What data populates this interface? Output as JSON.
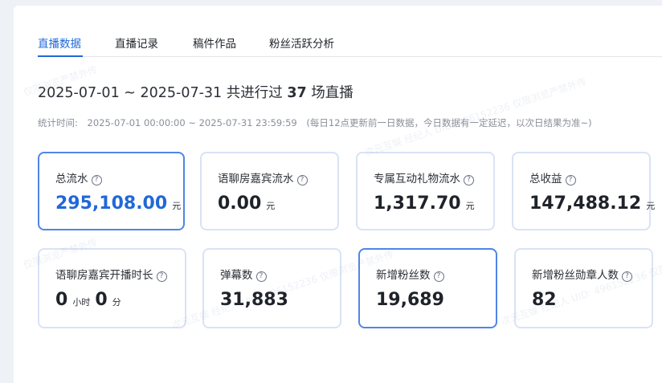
{
  "tabs": [
    {
      "label": "直播数据"
    },
    {
      "label": "直播记录"
    },
    {
      "label": "稿件作品"
    },
    {
      "label": "粉丝活跃分析"
    }
  ],
  "summary": {
    "range": "2025-07-01 ~ 2025-07-31",
    "prefix": "共进行过",
    "count": "37",
    "suffix": "场直播"
  },
  "stat_time": {
    "label": "统计时间:",
    "range": "2025-07-01 00:00:00 ~ 2025-07-31 23:59:59",
    "note": "(每日12点更新前一日数据，今日数据有一定延迟，以次日结果为准~)"
  },
  "cards": [
    {
      "title": "总流水",
      "value": "295,108.00",
      "unit": "元"
    },
    {
      "title": "语聊房嘉宾流水",
      "value": "0.00",
      "unit": "元"
    },
    {
      "title": "专属互动礼物流水",
      "value": "1,317.70",
      "unit": "元"
    },
    {
      "title": "总收益",
      "value": "147,488.12",
      "unit": "元"
    },
    {
      "title": "语聊房嘉宾开播时长",
      "hours": "0",
      "hours_unit": "小时",
      "minutes": "0",
      "minutes_unit": "分"
    },
    {
      "title": "弹幕数",
      "value": "31,883"
    },
    {
      "title": "新增粉丝数",
      "value": "19,689"
    },
    {
      "title": "新增粉丝勋章人数",
      "value": "82"
    }
  ],
  "help_glyph": "?",
  "watermark": {
    "text1": "次元互娱 经纪人 UID: 496152236 仅限浏览严禁外传",
    "text2": "仅限浏览严禁外传"
  },
  "colors": {
    "accent": "#2168d8",
    "selected_border": "#4f86e6",
    "card_border": "#d9e3f5"
  }
}
